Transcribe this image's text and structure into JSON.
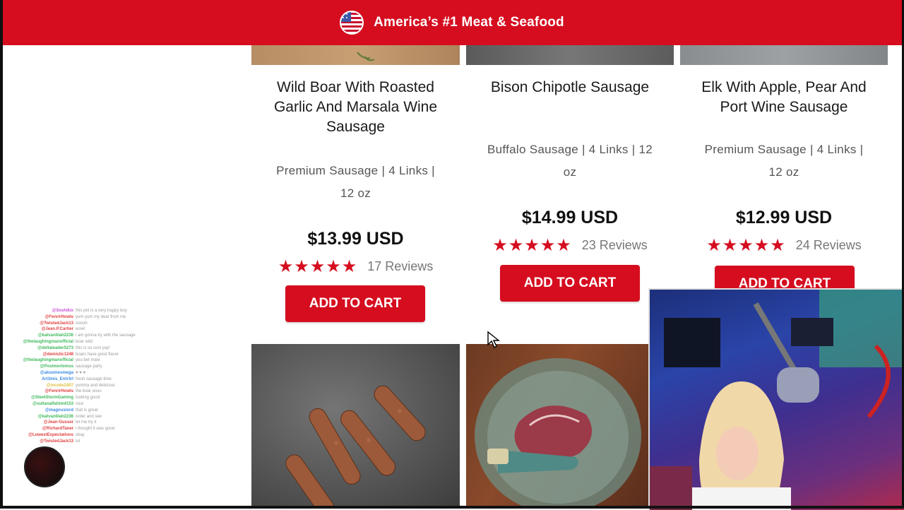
{
  "banner": {
    "title": "America’s #1 Meat & Seafood"
  },
  "products": [
    {
      "name_lines": [
        "Wild Boar With Roasted",
        "Garlic And Marsala Wine",
        "Sausage"
      ],
      "meta_lines": [
        "Premium Sausage | 4 Links |",
        "12 oz"
      ],
      "price": "$13.99 USD",
      "rating": 4.5,
      "stars": "★★★★★",
      "reviews": "17 Reviews",
      "cart_label": "ADD TO CART"
    },
    {
      "name_lines": [
        "Bison Chipotle Sausage"
      ],
      "meta_lines": [
        "Buffalo Sausage | 4 Links | 12",
        "oz"
      ],
      "price": "$14.99 USD",
      "rating": 5,
      "stars": "★★★★★",
      "reviews": "23 Reviews",
      "cart_label": "ADD TO CART"
    },
    {
      "name_lines": [
        "Elk With Apple, Pear And",
        "Port Wine Sausage"
      ],
      "meta_lines": [
        "Premium Sausage | 4 Links |",
        "12 oz"
      ],
      "price": "$12.99 USD",
      "rating": 5,
      "stars": "★★★★★",
      "reviews": "24 Reviews",
      "cart_label": "ADD TO CART"
    }
  ],
  "chat": [
    {
      "user": "@Soshikix",
      "msg": "this pet is a very happy boy",
      "color": "#c84fd8"
    },
    {
      "user": "@FenrirHowls",
      "msg": "yum yum my dear from me",
      "color": "#e04040"
    },
    {
      "user": "@TwistedJack13",
      "msg": "ooooh",
      "color": "#e04040"
    },
    {
      "user": "@Jean.P.Cartier",
      "msg": "wow!",
      "color": "#e04040"
    },
    {
      "user": "@katvanlilah2236",
      "msg": "i am gonna try with the sausage",
      "color": "#3fb95a"
    },
    {
      "user": "@thelaughingmanofficial",
      "msg": "boar wild",
      "color": "#3fb95a"
    },
    {
      "user": "@deltaleader5273",
      "msg": "this is so cool yay!",
      "color": "#3fb95a"
    },
    {
      "user": "@demistic1248",
      "msg": "boars have good flavor",
      "color": "#e04040"
    },
    {
      "user": "@thelaughingmanofficial",
      "msg": "you bet mate",
      "color": "#3fb95a"
    },
    {
      "user": "@Postmortemss",
      "msg": "sausage party",
      "color": "#3fb95a"
    },
    {
      "user": "@aksomesmega",
      "msg": "♥ ♥ ♥",
      "color": "#3a8ae0"
    },
    {
      "user": "Art3mis_Entr3rl",
      "msg": "fresh sausage time",
      "color": "#3a8ae0"
    },
    {
      "user": "@mcoke2407",
      "msg": "yummy and delicious",
      "color": "#e0c040"
    },
    {
      "user": "@FenrirHowls",
      "msg": "the boar ones",
      "color": "#e04040"
    },
    {
      "user": "@SteelStormGaming",
      "msg": "looking good",
      "color": "#3fb95a"
    },
    {
      "user": "@sultanalfahim4153",
      "msg": "nice",
      "color": "#3fb95a"
    },
    {
      "user": "@magnusiord",
      "msg": "that is great",
      "color": "#3a8ae0"
    },
    {
      "user": "@katvanlilah2236",
      "msg": "order and see",
      "color": "#3fb95a"
    },
    {
      "user": "@Jean-Gusser",
      "msg": "let me try it",
      "color": "#e04040"
    },
    {
      "user": "@RichardTaner",
      "msg": "i thought it was good",
      "color": "#e04040"
    },
    {
      "user": "@LowestExpectations",
      "msg": "okay",
      "color": "#e04040"
    },
    {
      "user": "@TwistedJack13",
      "msg": "lol",
      "color": "#e04040"
    }
  ],
  "colors": {
    "brand_red": "#d50d1f",
    "text_dark": "#1a1a1a",
    "text_muted": "#555555"
  },
  "icons": [
    "us-flag-icon",
    "star-icon",
    "mouse-cursor-icon"
  ]
}
